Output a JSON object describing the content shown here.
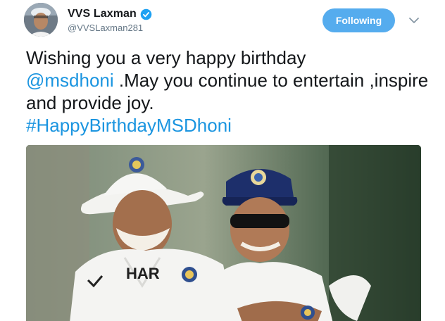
{
  "user": {
    "display_name": "VVS Laxman",
    "handle": "@VVSLaxman281",
    "verified": true
  },
  "actions": {
    "follow_label": "Following",
    "menu_icon": "chevron-down-icon"
  },
  "tweet": {
    "segments": [
      {
        "text": "Wishing you a very happy birthday ",
        "type": "text"
      },
      {
        "text": "@msdhoni",
        "type": "mention"
      },
      {
        "text": " .May you continue to entertain ,inspire and provide joy. ",
        "type": "text"
      },
      {
        "text": "#HappyBirthdayMSDhoni",
        "type": "hashtag"
      }
    ]
  },
  "media": {
    "shirt_text": "HAR"
  },
  "colors": {
    "accent": "#1b95e0",
    "follow_button": "#55acee",
    "secondary_text": "#657786"
  }
}
